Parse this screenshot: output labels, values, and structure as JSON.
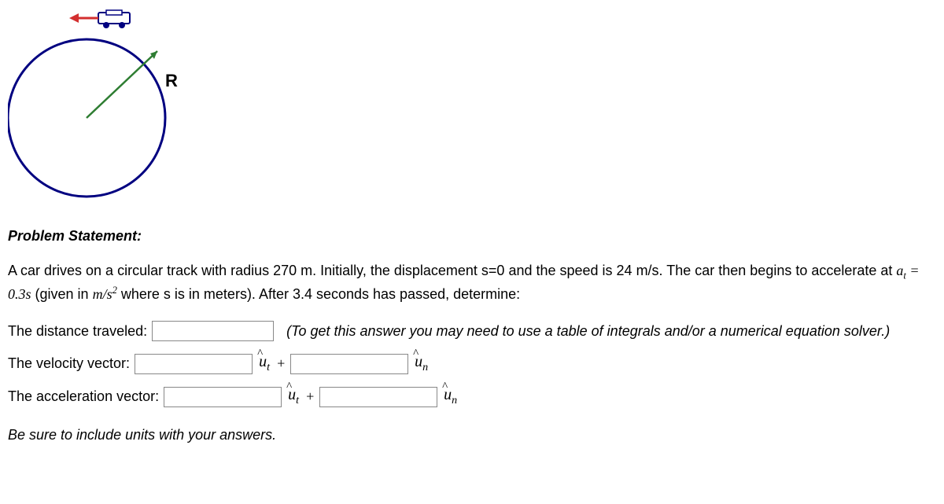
{
  "diagram": {
    "radius_label": "R"
  },
  "heading": "Problem Statement:",
  "paragraph": {
    "part1": "A car drives on a circular track with radius 270 m. Initially, the displacement s=0 and the speed is 24 m/s. The car then begins to accelerate at ",
    "a_var": "a",
    "a_sub": "t",
    "equals": " = 0.3",
    "s_var": "s",
    "given_in": " (given in ",
    "m_var": "m",
    "slash": "/",
    "s2_var": "s",
    "sq": "2",
    "part2": " where s is in meters). After 3.4 seconds has passed, determine:"
  },
  "distance": {
    "label": "The distance traveled:",
    "hint": "(To get this answer you may need to use a table of integrals and/or a numerical equation solver.)"
  },
  "velocity": {
    "label": "The velocity vector:"
  },
  "acceleration": {
    "label": "The acceleration vector:"
  },
  "unit_vectors": {
    "u": "u",
    "t_sub": "t",
    "n_sub": "n",
    "plus": "+"
  },
  "footer": "Be sure to include units with your answers."
}
